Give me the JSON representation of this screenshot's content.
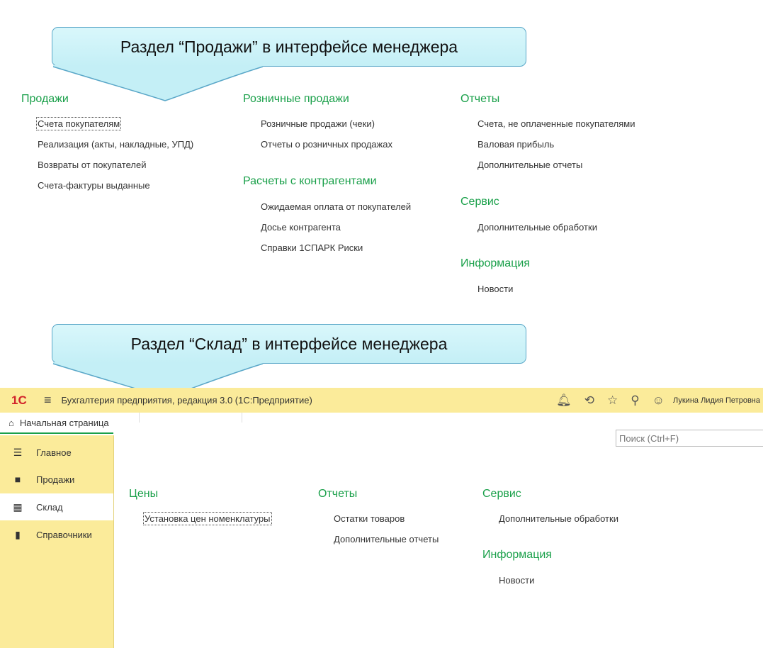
{
  "callout1": {
    "text": "Раздел “Продажи” в интерфейсе менеджера"
  },
  "sales": {
    "col1": {
      "title": "Продажи",
      "items": [
        "Счета покупателям",
        "Реализация (акты, накладные, УПД)",
        "Возвраты от покупателей",
        "Счета-фактуры выданные"
      ]
    },
    "col2": {
      "title": "Розничные продажи",
      "items": [
        "Розничные продажи (чеки)",
        "Отчеты о розничных продажах"
      ]
    },
    "col2b": {
      "title": "Расчеты с контрагентами",
      "items": [
        "Ожидаемая оплата от покупателей",
        "Досье контрагента",
        "Справки 1СПАРК Риски"
      ]
    },
    "col3": {
      "title": "Отчеты",
      "items": [
        "Счета, не оплаченные покупателями",
        "Валовая прибыль",
        "Дополнительные отчеты"
      ]
    },
    "col3b": {
      "title": "Сервис",
      "items": [
        "Дополнительные обработки"
      ]
    },
    "col3c": {
      "title": "Информация",
      "items": [
        "Новости"
      ]
    }
  },
  "callout2": {
    "text": "Раздел “Склад” в интерфейсе менеджера"
  },
  "app": {
    "logo": "1С",
    "title": "Бухгалтерия предприятия, редакция 3.0  (1С:Предприятие)",
    "user": "Лукина Лидия Петровна",
    "home_tab": "Начальная страница",
    "search_placeholder": "Поиск (Ctrl+F)",
    "icons": [
      "menu-icon",
      "bell-icon",
      "history-icon",
      "star-icon",
      "search-icon",
      "users-icon",
      "home-icon"
    ],
    "accent_color": "#1aa04a",
    "panel_color": "#fbeb9a",
    "sidebar": [
      {
        "label": "Главное",
        "icon": "list-icon"
      },
      {
        "label": "Продажи",
        "icon": "bag-icon"
      },
      {
        "label": "Склад",
        "icon": "warehouse-icon",
        "active": true
      },
      {
        "label": "Справочники",
        "icon": "books-icon"
      }
    ]
  },
  "warehouse": {
    "col1": {
      "title": "Цены",
      "items": [
        "Установка цен номенклатуры"
      ]
    },
    "col2": {
      "title": "Отчеты",
      "items": [
        "Остатки товаров",
        "Дополнительные отчеты"
      ]
    },
    "col3": {
      "title": "Сервис",
      "items": [
        "Дополнительные обработки"
      ]
    },
    "col3b": {
      "title": "Информация",
      "items": [
        "Новости"
      ]
    }
  }
}
